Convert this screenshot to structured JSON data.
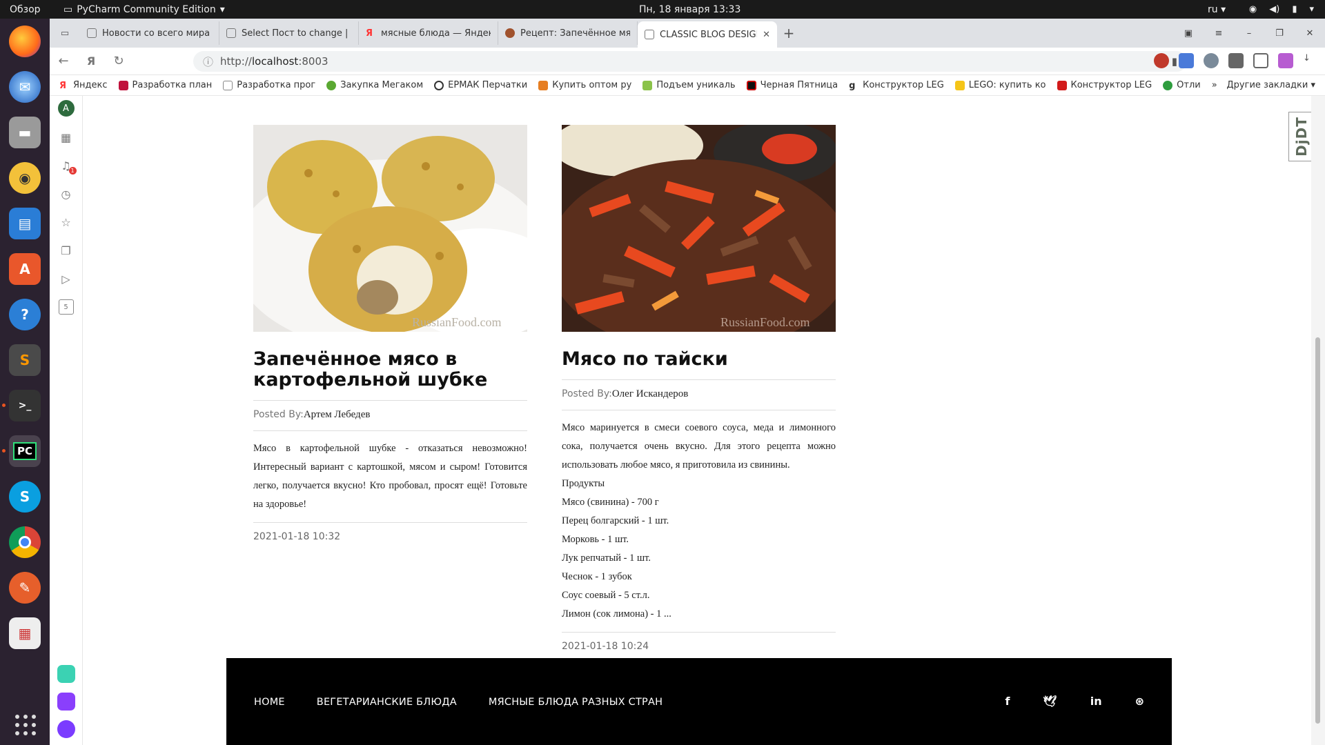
{
  "os": {
    "overview": "Обзор",
    "app_name": "PyCharm Community Edition",
    "clock": "Пн, 18 января  13:33",
    "lang": "ru"
  },
  "browser": {
    "tabs": [
      {
        "title": "Новости со всего мира",
        "active": false
      },
      {
        "title": "Select Пост to change | Dja",
        "active": false
      },
      {
        "title": "мясные блюда — Яндекс",
        "active": false
      },
      {
        "title": "Рецепт: Запечённое мясо",
        "active": false
      },
      {
        "title": "CLASSIC BLOG DESIGN",
        "active": true
      }
    ],
    "url_prefix": "http://",
    "url_host": "localhost",
    "url_port": ":8003",
    "bookmarks": [
      "Яндекс",
      "Разработка план",
      "Разработка прог",
      "Закупка Мегаком",
      "ЕРМАК Перчатки",
      "Купить оптом ру",
      "Подъем уникаль",
      "Черная Пятница",
      "Конструктор LEG",
      "LEGO: купить ко",
      "Конструктор LEG",
      "Отли"
    ],
    "other_bookmarks": "Другие закладки",
    "sidebar_avatar": "A",
    "notif_count": "1",
    "side_counter": "5",
    "djdt": "DjDT"
  },
  "posts": [
    {
      "title": "Запечённое мясо в картофельной шубке",
      "posted_by_label": "Posted By:",
      "author": "Артем Лебедев",
      "body": "Мясо в картофельной шубке - отказаться невозможно! Интересный вариант с картошкой, мясом и сыром! Готовится легко, получается вкусно! Кто пробовал, просят ещё! Готовьте на здоровье!",
      "date": "2021-01-18 10:32",
      "image_watermark": "RussianFood.com"
    },
    {
      "title": "Мясо по тайски",
      "posted_by_label": "Posted By:",
      "author": "Олег Искандеров",
      "body": "Мясо маринуется в смеси соевого соуса, меда и лимонного сока, получается очень вкусно. Для этого рецепта можно использовать любое мясо, я приготовила из свинины.",
      "ingredients": [
        "Продукты",
        "Мясо (свинина) - 700 г",
        "Перец болгарский - 1 шт.",
        "Морковь - 1 шт.",
        "Лук репчатый - 1 шт.",
        "Чеснок - 1 зубок",
        "Соус соевый - 5 ст.л.",
        "Лимон (сок лимона) - 1 ..."
      ],
      "date": "2021-01-18 10:24",
      "image_watermark": "RussianFood.com"
    }
  ],
  "footer": {
    "menu": [
      "HOME",
      "ВЕГЕТАРИАНСКИЕ БЛЮДА",
      "МЯСНЫЕ БЛЮДА РАЗНЫХ СТРАН"
    ],
    "social": [
      "facebook-icon",
      "twitter-icon",
      "linkedin-icon",
      "dribbble-icon"
    ]
  }
}
